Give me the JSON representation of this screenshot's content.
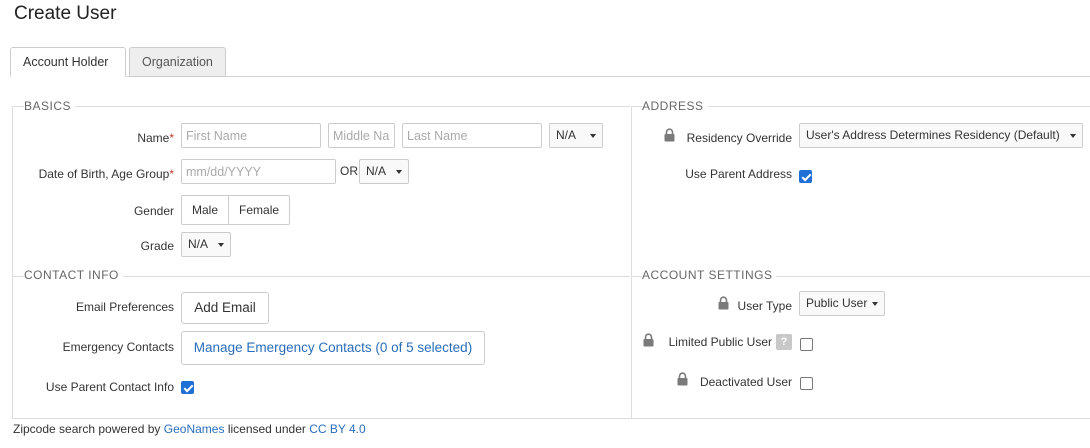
{
  "page": {
    "title": "Create User"
  },
  "tabs": [
    {
      "label": "Account Holder",
      "active": true
    },
    {
      "label": "Organization",
      "active": false
    }
  ],
  "basics": {
    "title": "BASICS",
    "name_label": "Name",
    "required_mark": "*",
    "first_name_placeholder": "First Name",
    "middle_name_placeholder": "Middle Na",
    "last_name_placeholder": "Last Name",
    "suffix_value": "N/A",
    "dob_label": "Date of Birth, Age Group",
    "dob_placeholder": "mm/dd/YYYY",
    "or_text": "OR",
    "age_group_value": "N/A",
    "gender_label": "Gender",
    "gender_options": [
      "Male",
      "Female"
    ],
    "grade_label": "Grade",
    "grade_value": "N/A"
  },
  "contact": {
    "title": "CONTACT INFO",
    "email_label": "Email Preferences",
    "add_email_button": "Add Email",
    "emergency_label": "Emergency Contacts",
    "manage_emergency_button": "Manage Emergency Contacts (0 of 5 selected)",
    "use_parent_contact_label": "Use Parent Contact Info",
    "use_parent_contact_checked": true
  },
  "address": {
    "title": "ADDRESS",
    "residency_label": "Residency Override",
    "residency_value": "User's Address Determines Residency (Default)",
    "use_parent_address_label": "Use Parent Address",
    "use_parent_address_checked": true
  },
  "account_settings": {
    "title": "ACCOUNT SETTINGS",
    "user_type_label": "User Type",
    "user_type_value": "Public User",
    "limited_public_label": "Limited Public User",
    "help_glyph": "?",
    "limited_public_checked": false,
    "deactivated_label": "Deactivated User",
    "deactivated_checked": false
  },
  "footer": {
    "prefix": "Zipcode search powered by",
    "geonames_link": "GeoNames",
    "middle": "licensed under",
    "license_link": "CC BY 4.0"
  },
  "colors": {
    "link": "#2a6ebb",
    "checkbox_checked": "#1f6fd6",
    "required": "#c0392b"
  }
}
